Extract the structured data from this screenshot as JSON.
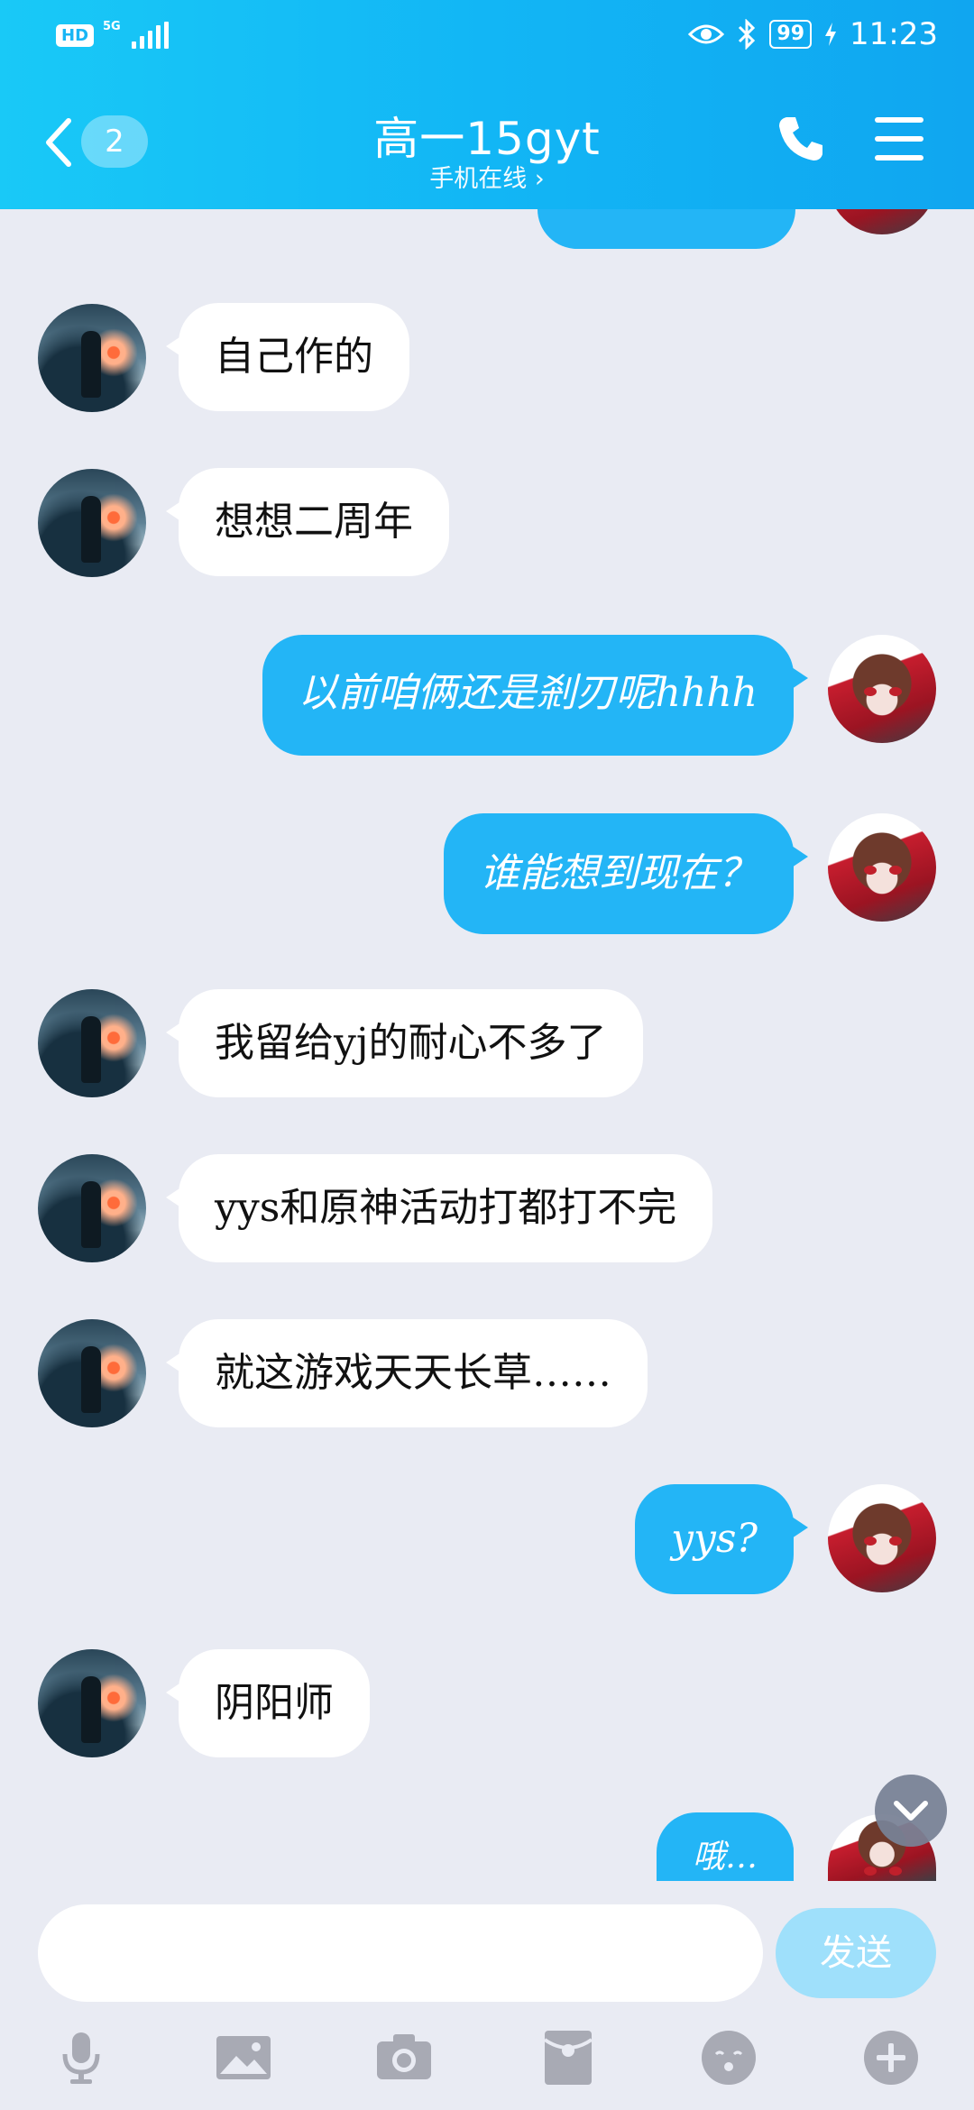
{
  "status_bar": {
    "hd_label": "HD",
    "network_label": "5G",
    "battery_label": "99",
    "time": "11:23"
  },
  "header": {
    "unread_count": "2",
    "title": "高一15gyt",
    "subtitle": "手机在线 ›"
  },
  "messages": [
    {
      "side": "them",
      "text": "自己作的"
    },
    {
      "side": "them",
      "text": "想想二周年"
    },
    {
      "side": "me",
      "text": "以前咱俩还是剎刃呢hhhh"
    },
    {
      "side": "me",
      "text": "谁能想到现在？"
    },
    {
      "side": "them",
      "text": "我留给yj的耐心不多了"
    },
    {
      "side": "them",
      "text": "yys和原神活动打都打不完"
    },
    {
      "side": "them",
      "text": "就这游戏天天长草……"
    },
    {
      "side": "me",
      "text": "yys?"
    },
    {
      "side": "them",
      "text": "阴阳师"
    },
    {
      "side": "me",
      "text": "哦…"
    }
  ],
  "input": {
    "send_label": "发送"
  },
  "toolbar": {
    "icons": [
      "microphone-icon",
      "image-icon",
      "camera-icon",
      "red-packet-icon",
      "emoji-icon",
      "plus-icon"
    ]
  },
  "colors": {
    "header_gradient_start": "#19c9f7",
    "header_gradient_end": "#10a6f0",
    "my_bubble": "#23b5f6",
    "their_bubble": "#ffffff",
    "background": "#e9ebf3",
    "send_button": "#9fe0fb"
  }
}
